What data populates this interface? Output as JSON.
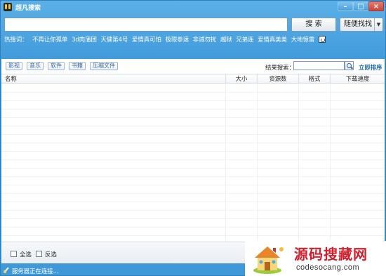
{
  "window": {
    "title": "超凡搜索",
    "min_label": "–",
    "max_label": "□",
    "close_label": "×"
  },
  "search": {
    "value": "",
    "button_label": "搜 索",
    "random_label": "随便找找",
    "random_arrow": "▼"
  },
  "hot": {
    "label": "热搜词：",
    "words": [
      "不再让你孤单",
      "3d肉蒲团",
      "天健第4号",
      "爱情真可怕",
      "极限拳速",
      "非诚勿扰",
      "越狱",
      "兄弟连",
      "爱情真美美",
      "大地惊雷"
    ]
  },
  "categories": [
    "影视",
    "音乐",
    "软件",
    "书籍",
    "压缩文件"
  ],
  "result_search": {
    "label": "结果搜索：",
    "value": "",
    "sort_label": "立即排序"
  },
  "table": {
    "columns": [
      "名称",
      "大小",
      "资源数",
      "格式",
      "下载速度"
    ],
    "rows": []
  },
  "footer": {
    "select_all": "全选",
    "invert": "反选"
  },
  "status": {
    "text": "服务器正在连接..."
  },
  "watermark": {
    "title": "源码搜藏网",
    "url": "codesocang.com"
  },
  "colors": {
    "window_blue": "#3f99d9",
    "link_blue": "#1e6ab0",
    "watermark_red": "#d11f2c"
  }
}
